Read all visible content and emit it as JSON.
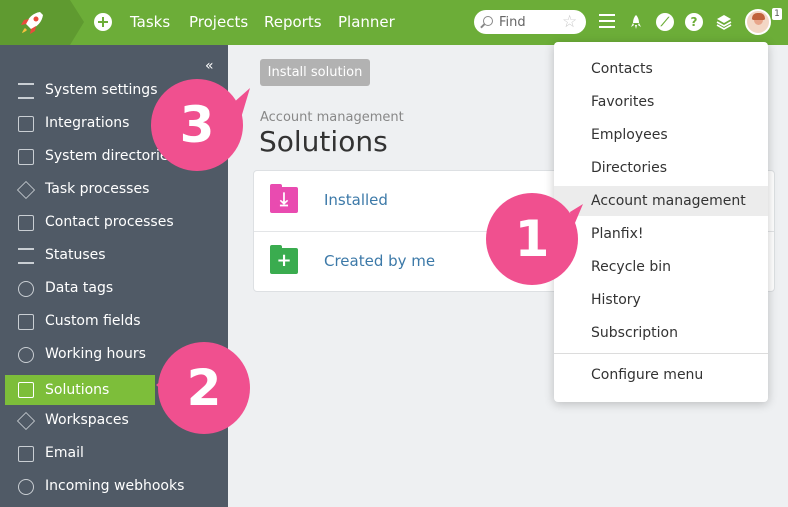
{
  "nav": {
    "links": [
      "Tasks",
      "Projects",
      "Reports",
      "Planner"
    ],
    "search_placeholder": "Find",
    "notification_count": "1"
  },
  "sidebar": {
    "items": [
      {
        "label": "System settings",
        "icon": "sliders-icon"
      },
      {
        "label": "Integrations",
        "icon": "integrations-icon"
      },
      {
        "label": "System directories",
        "icon": "directories-icon"
      },
      {
        "label": "Task processes",
        "icon": "task-processes-icon"
      },
      {
        "label": "Contact processes",
        "icon": "contact-processes-icon"
      },
      {
        "label": "Statuses",
        "icon": "statuses-icon"
      },
      {
        "label": "Data tags",
        "icon": "data-tags-icon"
      },
      {
        "label": "Custom fields",
        "icon": "custom-fields-icon"
      },
      {
        "label": "Working hours",
        "icon": "clock-icon"
      },
      {
        "label": "Solutions",
        "icon": "solutions-icon",
        "active": true
      },
      {
        "label": "Workspaces",
        "icon": "workspaces-icon"
      },
      {
        "label": "Email",
        "icon": "email-icon"
      },
      {
        "label": "Incoming webhooks",
        "icon": "webhooks-icon"
      }
    ]
  },
  "main": {
    "install_button": "Install solution",
    "breadcrumb": "Account management",
    "title": "Solutions",
    "rows": [
      {
        "label": "Installed",
        "icon": "download-folder-icon",
        "color": "#e94bb0"
      },
      {
        "label": "Created by me",
        "icon": "plus-folder-icon",
        "color": "#3aac4f"
      }
    ]
  },
  "menu": {
    "items": [
      "Contacts",
      "Favorites",
      "Employees",
      "Directories",
      "Account management",
      "Planfix!",
      "Recycle bin",
      "History",
      "Subscription"
    ],
    "highlighted": "Account management",
    "footer": "Configure menu"
  },
  "callouts": [
    "1",
    "2",
    "3"
  ],
  "colors": {
    "topbar": "#6cad38",
    "sidebar": "#505a66",
    "active": "#7dbe3a",
    "callout": "#f0508f",
    "link": "#3c79a8"
  }
}
